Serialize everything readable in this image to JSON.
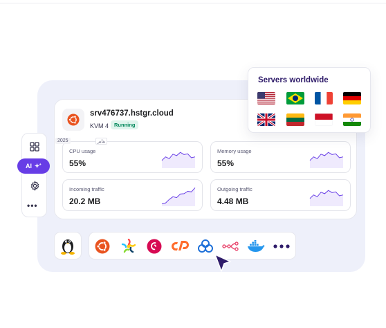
{
  "server": {
    "os_icon": "ubuntu-icon",
    "hostname": "srv476737.hstgr.cloud",
    "plan": "KVM 4",
    "status": "Running",
    "status_color": "#00875a"
  },
  "overlay_tags": {
    "year": "2025",
    "arabic": "يناير"
  },
  "metrics": [
    {
      "label": "CPU usage",
      "value": "55%",
      "trend": [
        0.35,
        0.55,
        0.45,
        0.7,
        0.62,
        0.8,
        0.68,
        0.72,
        0.5,
        0.55
      ]
    },
    {
      "label": "Memory usage",
      "value": "55%",
      "trend": [
        0.35,
        0.55,
        0.45,
        0.7,
        0.62,
        0.8,
        0.68,
        0.72,
        0.5,
        0.55
      ]
    },
    {
      "label": "Incoming traffic",
      "value": "20.2 MB",
      "trend": [
        0.05,
        0.1,
        0.3,
        0.45,
        0.4,
        0.6,
        0.62,
        0.75,
        0.72,
        0.95
      ]
    },
    {
      "label": "Outgoing traffic",
      "value": "4.48 MB",
      "trend": [
        0.35,
        0.55,
        0.45,
        0.7,
        0.62,
        0.8,
        0.68,
        0.72,
        0.5,
        0.55
      ]
    }
  ],
  "sidebar": {
    "items": [
      {
        "name": "dashboard-icon"
      },
      {
        "name": "ai-assistant",
        "label": "AI"
      },
      {
        "name": "settings-icon"
      },
      {
        "name": "more-icon"
      }
    ]
  },
  "servers_worldwide": {
    "title": "Servers worldwide",
    "flags": [
      "us-flag",
      "brazil-flag",
      "france-flag",
      "germany-flag",
      "uk-flag",
      "lithuania-flag",
      "indonesia-flag",
      "india-flag"
    ]
  },
  "os_options": [
    "linux-icon",
    "ubuntu-icon",
    "almalinux-icon",
    "debian-icon",
    "cpanel-icon",
    "cloudpanel-icon",
    "n8n-icon",
    "docker-icon",
    "more-icon"
  ],
  "colors": {
    "accent": "#673de6",
    "ubuntu": "#e95420",
    "chart_line": "#673de6"
  }
}
